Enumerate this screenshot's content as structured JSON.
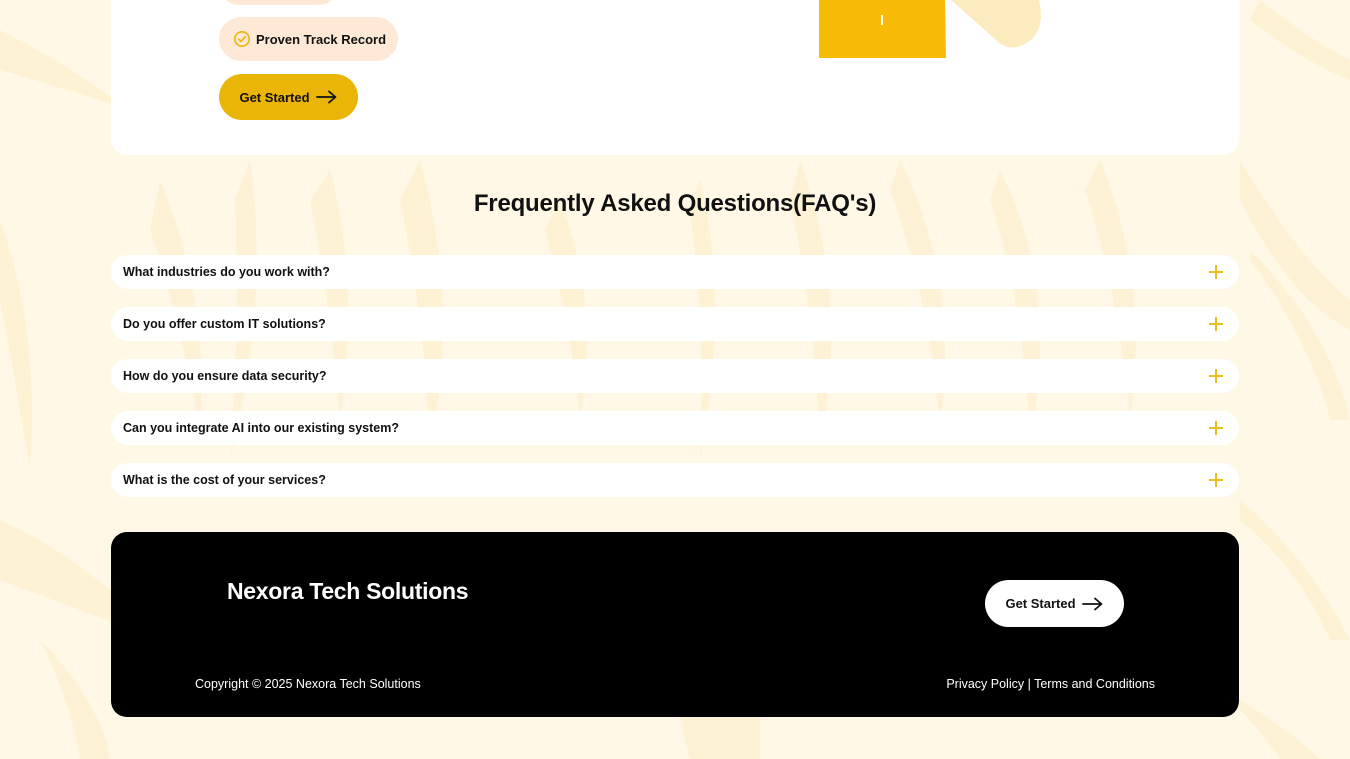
{
  "hero": {
    "feature_label": "Proven Track Record",
    "cta_label": "Get Started"
  },
  "faq": {
    "title": "Frequently Asked Questions(FAQ's)",
    "items": [
      {
        "question": "What industries do you work with?"
      },
      {
        "question": "Do you offer custom IT solutions?"
      },
      {
        "question": "How do you ensure data security?"
      },
      {
        "question": "Can you integrate AI into our existing system?"
      },
      {
        "question": "What is the cost of your services?"
      }
    ]
  },
  "footer": {
    "brand": "Nexora Tech Solutions",
    "cta_label": "Get Started",
    "copyright": "Copyright © 2025 Nexora Tech Solutions",
    "privacy_label": "Privacy Policy",
    "separator": "|",
    "terms_label": "Terms and Conditions"
  },
  "colors": {
    "accent": "#ebb507",
    "pill_bg": "#fde9d6",
    "page_bg": "#fff8e7",
    "footer_bg": "#000000"
  },
  "icons": {
    "check": "check-circle-icon",
    "arrow": "arrow-right-icon",
    "plus": "plus-icon"
  }
}
